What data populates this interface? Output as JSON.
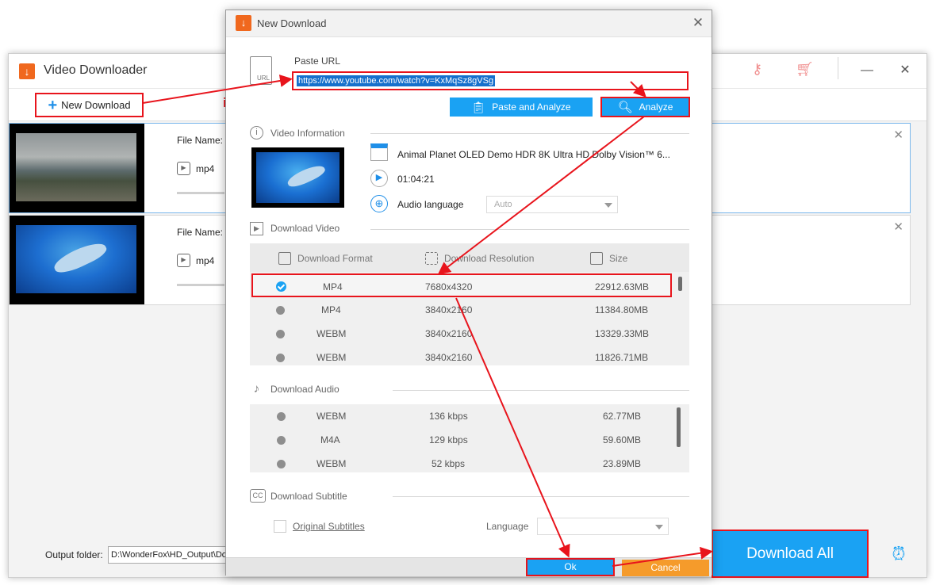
{
  "app": {
    "title": "Video Downloader",
    "new_download": "New Download",
    "output_folder_label": "Output folder:",
    "output_folder_value": "D:\\WonderFox\\HD_Output\\Do",
    "download_all": "Download All"
  },
  "items": [
    {
      "file_name_label": "File Name:",
      "format": "mp4"
    },
    {
      "file_name_label": "File Name:",
      "format": "mp4"
    }
  ],
  "dialog": {
    "title": "New Download",
    "paste_url_label": "Paste URL",
    "url_value": "https://www.youtube.com/watch?v=KxMqSz8gVSg",
    "paste_analyze": "Paste and Analyze",
    "analyze": "Analyze",
    "video_info_label": "Video Information",
    "video_title": "Animal Planet OLED Demo HDR 8K Ultra HD Dolby Vision™ 6...",
    "duration": "01:04:21",
    "audio_language_label": "Audio language",
    "audio_language_value": "Auto",
    "download_video_label": "Download Video",
    "columns": [
      "Download Format",
      "Download Resolution",
      "Size"
    ],
    "video_rows": [
      {
        "format": "MP4",
        "resolution": "7680x4320",
        "size": "22912.63MB",
        "selected": true
      },
      {
        "format": "MP4",
        "resolution": "3840x2160",
        "size": "11384.80MB",
        "selected": false
      },
      {
        "format": "WEBM",
        "resolution": "3840x2160",
        "size": "13329.33MB",
        "selected": false
      },
      {
        "format": "WEBM",
        "resolution": "3840x2160",
        "size": "11826.71MB",
        "selected": false
      }
    ],
    "download_audio_label": "Download Audio",
    "audio_rows": [
      {
        "format": "WEBM",
        "bitrate": "136 kbps",
        "size": "62.77MB"
      },
      {
        "format": "M4A",
        "bitrate": "129 kbps",
        "size": "59.60MB"
      },
      {
        "format": "WEBM",
        "bitrate": "52 kbps",
        "size": "23.89MB"
      }
    ],
    "download_subtitle_label": "Download Subtitle",
    "original_subtitles": "Original Subtitles",
    "language_label": "Language",
    "ok": "Ok",
    "cancel": "Cancel"
  },
  "colors": {
    "accent_blue": "#1aa2f3",
    "highlight_red": "#e8141c",
    "cancel_orange": "#f59b2b",
    "logo_orange": "#f0681e"
  }
}
